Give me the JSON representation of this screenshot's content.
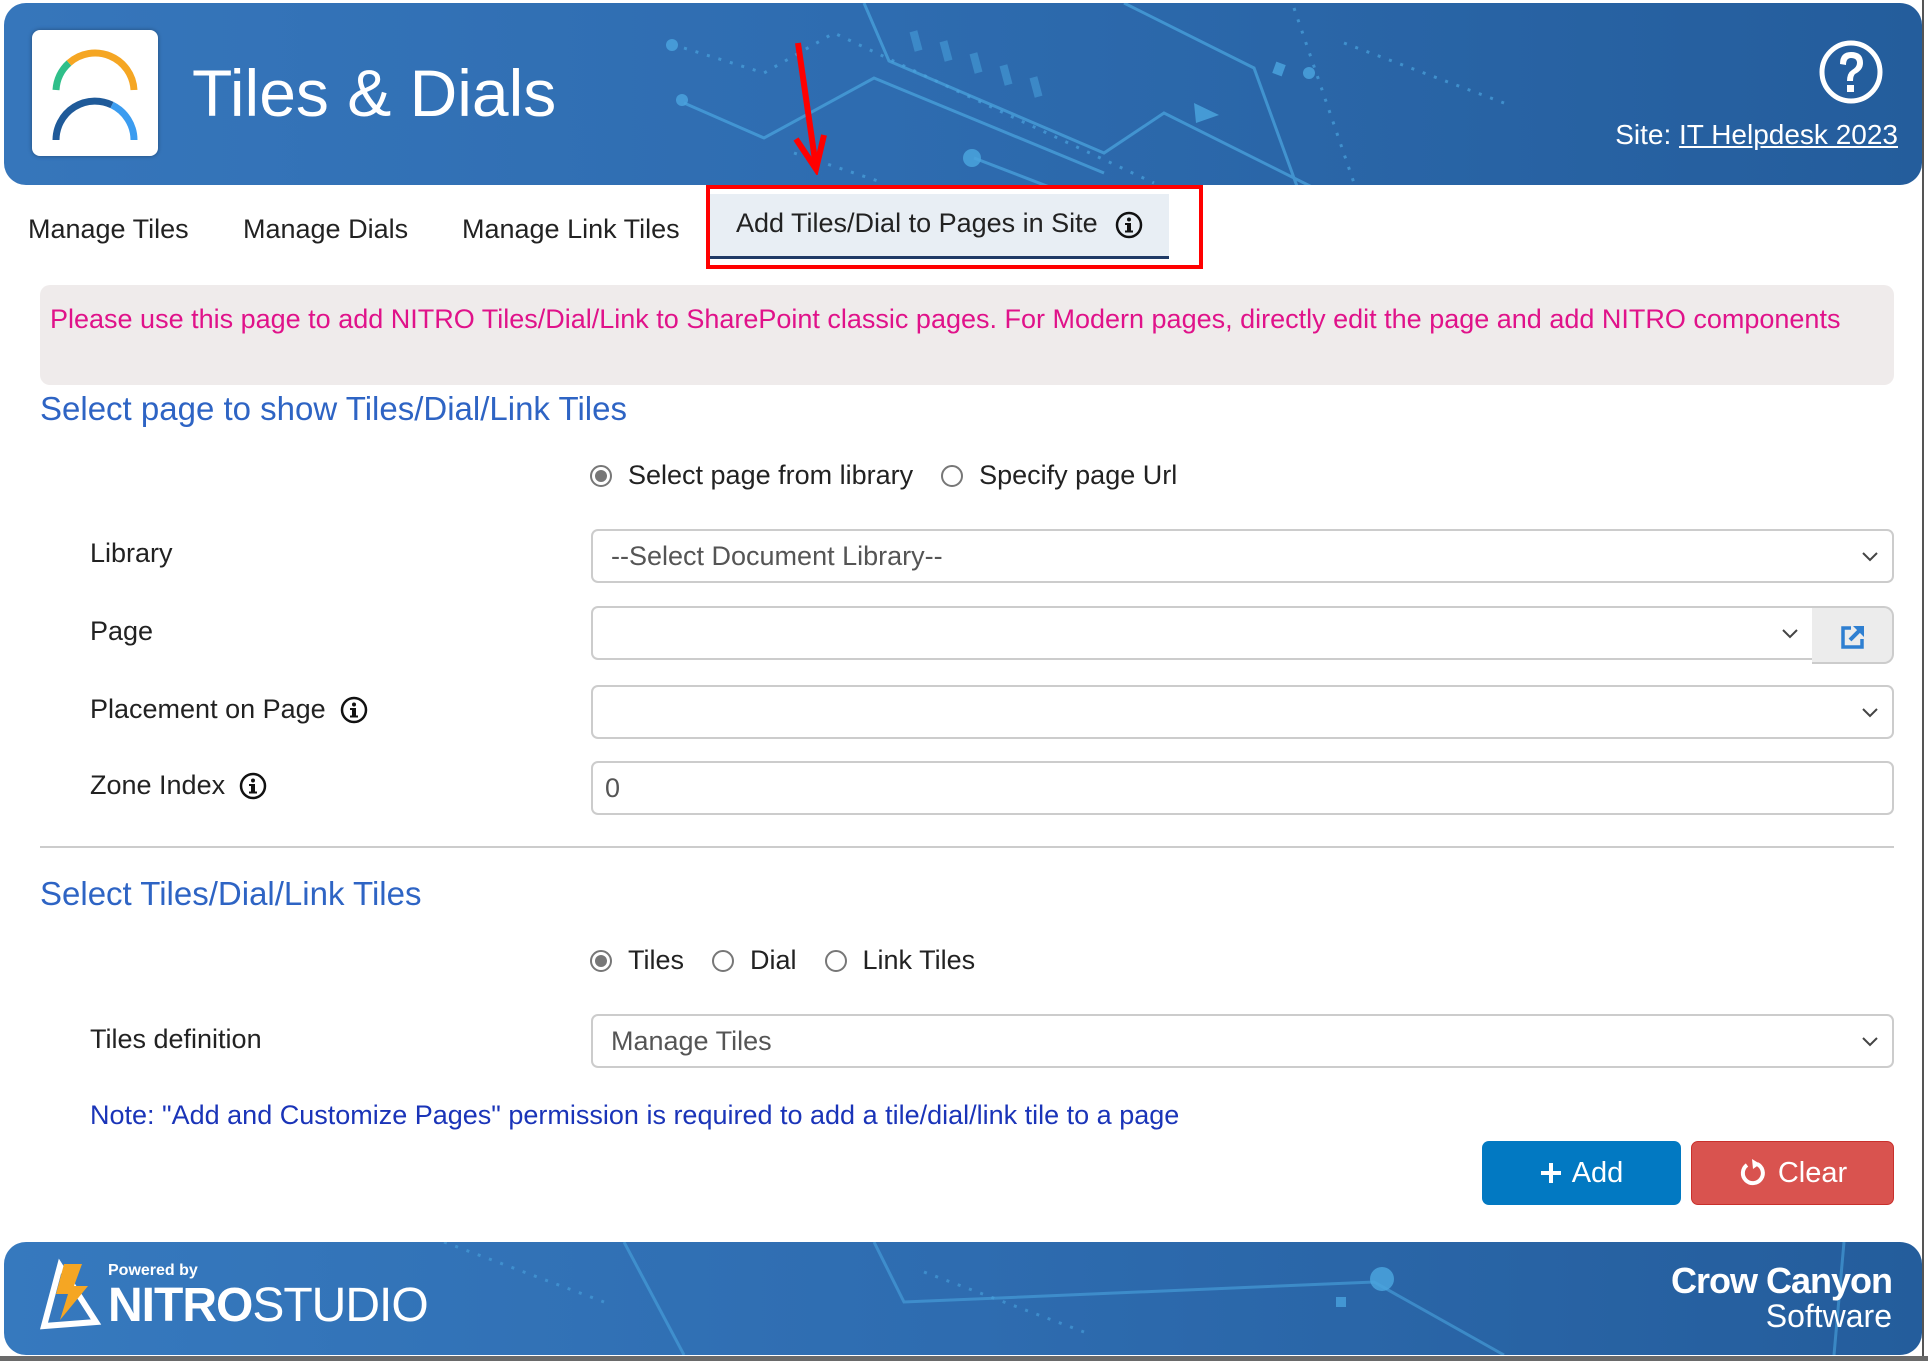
{
  "header": {
    "title": "Tiles & Dials",
    "site_label": "Site: ",
    "site_name": "IT Helpdesk 2023",
    "icons": {
      "logo": "tiles-dials-logo",
      "help": "help-circle-icon"
    }
  },
  "tabs": [
    {
      "label": "Manage Tiles",
      "active": false
    },
    {
      "label": "Manage Dials",
      "active": false
    },
    {
      "label": "Manage Link Tiles",
      "active": false
    },
    {
      "label": "Add Tiles/Dial to Pages in Site",
      "active": true,
      "icon": "info-icon"
    }
  ],
  "alert": {
    "text": "Please use this page to add NITRO Tiles/Dial/Link to SharePoint classic pages. For Modern pages, directly edit the page and add NITRO components",
    "color": "#e0128a"
  },
  "section1": {
    "title": "Select page to show Tiles/Dial/Link Tiles",
    "source_options": [
      {
        "label": "Select page from library",
        "checked": true
      },
      {
        "label": "Specify page Url",
        "checked": false
      }
    ],
    "fields": {
      "library": {
        "label": "Library",
        "value": "--Select Document Library--"
      },
      "page": {
        "label": "Page",
        "value": ""
      },
      "placement": {
        "label": "Placement on Page",
        "value": ""
      },
      "zone_index": {
        "label": "Zone Index",
        "value": "0"
      }
    }
  },
  "section2": {
    "title": "Select Tiles/Dial/Link Tiles",
    "type_options": [
      {
        "label": "Tiles",
        "checked": true
      },
      {
        "label": "Dial",
        "checked": false
      },
      {
        "label": "Link Tiles",
        "checked": false
      }
    ],
    "definition": {
      "label": "Tiles definition",
      "value": "Manage Tiles"
    },
    "note": "Note: \"Add and Customize Pages\" permission is required to add a tile/dial/link tile to a page"
  },
  "actions": {
    "add_label": "Add",
    "clear_label": "Clear",
    "add_color": "#0279c2",
    "clear_color": "#d9534f"
  },
  "footer": {
    "powered_by": "Powered by",
    "brand_bold": "NITRO",
    "brand_light": "STUDIO",
    "company_line1": "Crow Canyon",
    "company_line2": "Software"
  }
}
